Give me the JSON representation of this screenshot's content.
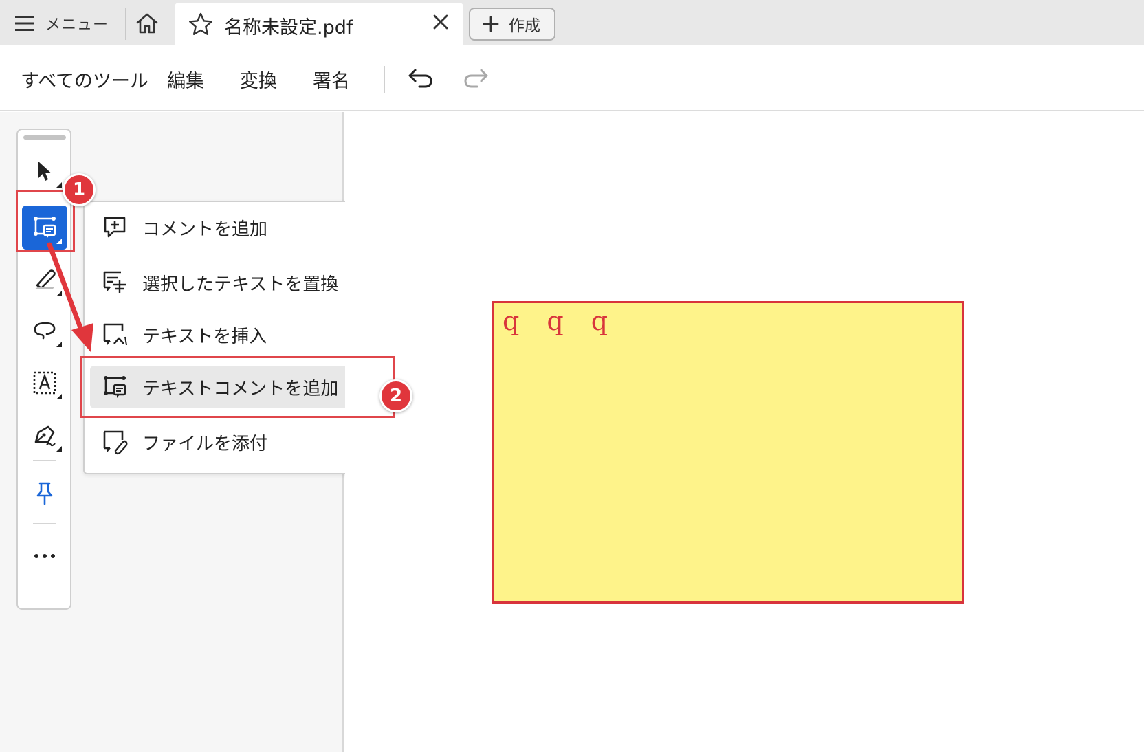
{
  "tabbar": {
    "menu_label": "メニュー",
    "document_tab_title": "名称未設定.pdf",
    "create_label": "作成"
  },
  "toolbar": {
    "items": [
      {
        "label": "すべてのツール"
      },
      {
        "label": "編集"
      },
      {
        "label": "変換"
      },
      {
        "label": "署名"
      }
    ]
  },
  "comment_menu": {
    "items": [
      {
        "label": "コメントを追加",
        "icon": "add-comment-icon"
      },
      {
        "label": "選択したテキストを置換",
        "icon": "replace-text-icon"
      },
      {
        "label": "テキストを挿入",
        "icon": "insert-text-icon"
      },
      {
        "label": "テキストコメントを追加",
        "icon": "text-comment-icon",
        "selected": true
      },
      {
        "label": "ファイルを添付",
        "icon": "attach-file-icon"
      }
    ]
  },
  "annotations": {
    "badge_1": "1",
    "badge_2": "2",
    "accent_color": "#e0363c"
  },
  "document": {
    "note_text": "q q q",
    "note_fill": "#fef38a",
    "note_border": "#d8343c"
  },
  "colors": {
    "active_tool": "#1a66d8",
    "check": "#1a66d8"
  }
}
